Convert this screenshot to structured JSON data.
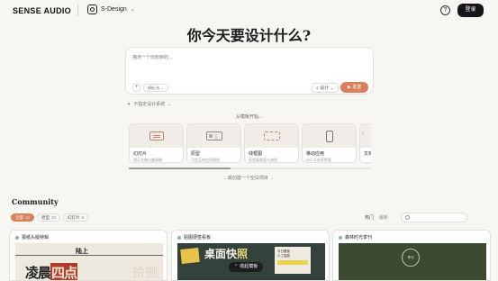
{
  "header": {
    "brand": "SENSE AUDIO",
    "project_name": "S-Design",
    "login_label": "登录"
  },
  "hero": {
    "title": "你今天要设计什么?"
  },
  "composer": {
    "placeholder": "描述一个你想要的...",
    "chip_label": "模板 选",
    "design_label": "设计",
    "send_label": "发送"
  },
  "specify_label": "不指定设计系统",
  "templates": {
    "label": "从模板开始...",
    "items": [
      {
        "name": "幻灯片",
        "desc": "演示文稿与路演稿",
        "icon": "slides-icon"
      },
      {
        "name": "原型",
        "desc": "可交互的应用模型",
        "icon": "prototype-icon"
      },
      {
        "name": "线框图",
        "desc": "低保真版面与流程",
        "icon": "wireframe-icon"
      },
      {
        "name": "移动应用",
        "desc": "iOS 与安卓界面",
        "icon": "mobile-icon"
      },
      {
        "name": "文档",
        "desc": "",
        "icon": "doc-icon"
      }
    ],
    "or_label": "...或创建一个空白项目 →"
  },
  "community": {
    "title": "Community",
    "filters": [
      {
        "label": "全部",
        "count": "19",
        "active": true
      },
      {
        "label": "原型",
        "count": "10",
        "active": false
      },
      {
        "label": "幻灯片",
        "count": "9",
        "active": false
      }
    ],
    "sort": {
      "hot": "热门",
      "latest": "最新"
    },
    "cards": [
      {
        "title": "报纸头版特辑",
        "masthead": "陆上",
        "headline_a": "凌晨",
        "headline_b": "四点",
        "faint": "拾捌"
      },
      {
        "title": "贴图便签看板",
        "headline": "桌面快",
        "headline_tail": "照",
        "note_line": "今日看板",
        "note_sub": "人工智能"
      },
      {
        "title": "森林时光季刊",
        "badge": "季刊"
      }
    ],
    "collapse_label": "收起模板"
  },
  "colors": {
    "accent": "#d9805a",
    "dark": "#16161a",
    "background": "#f7f6f3"
  }
}
